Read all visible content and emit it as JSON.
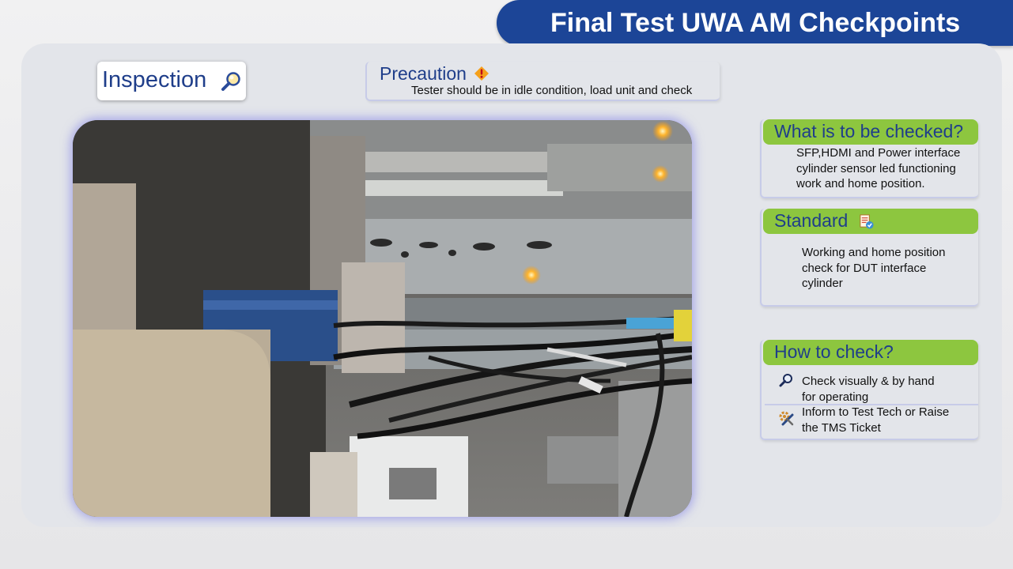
{
  "header": {
    "title": "Final Test UWA AM Checkpoints"
  },
  "inspection": {
    "label": "Inspection",
    "icon": "magnifier-icon"
  },
  "precaution": {
    "title": "Precaution",
    "icon": "warning-icon",
    "text": "Tester should be in idle condition, load unit and check"
  },
  "checked": {
    "title": "What is to be checked?",
    "lines": [
      "SFP,HDMI and Power interface",
      "cylinder sensor led functioning",
      "work and home position."
    ]
  },
  "standard": {
    "title": "Standard",
    "icon": "checklist-icon",
    "lines": [
      "Working and home position",
      "check for DUT interface",
      "cylinder"
    ]
  },
  "how": {
    "title": "How to check?",
    "items": [
      {
        "icon": "magnifier-icon",
        "lines": [
          "Check visually & by hand",
          "for operating"
        ]
      },
      {
        "icon": "tools-icon",
        "lines": [
          "Inform to Test Tech or Raise",
          "the TMS Ticket"
        ]
      }
    ]
  },
  "colors": {
    "brand_blue": "#1c4597",
    "header_green": "#8dc63f",
    "title_text_blue": "#1f3e8a"
  }
}
